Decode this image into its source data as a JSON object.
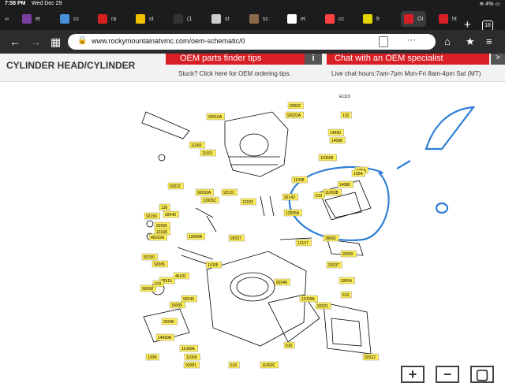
{
  "status": {
    "time": "7:58 PM",
    "date": "Wed Dec 29",
    "battery": "4%"
  },
  "tabs": [
    {
      "label": "et",
      "color": "#7b3fa0"
    },
    {
      "label": "cc",
      "color": "#4a90d9"
    },
    {
      "label": "ra",
      "color": "#d62020"
    },
    {
      "label": "st",
      "color": "#f0c000"
    },
    {
      "label": "(1",
      "color": "#333333"
    },
    {
      "label": "st",
      "color": "#cccccc"
    },
    {
      "label": "sc",
      "color": "#8a6a4a"
    },
    {
      "label": "et",
      "color": "#ffffff"
    },
    {
      "label": "cc",
      "color": "#ff4040"
    },
    {
      "label": "fr",
      "color": "#e6d400"
    },
    {
      "label": "OI",
      "color": "#d81f26"
    },
    {
      "label": "ht",
      "color": "#d81f26"
    }
  ],
  "tab_count": "18",
  "url": "www.rockymountainatvmc.com/oem-schematic/0",
  "page": {
    "title": "CYLINDER HEAD/CYLINDER",
    "promo_left": "OEM parts finder tips",
    "promo_left_sub": "Stuck? Click here for OEM ordering tips.",
    "promo_right": "Chat with an OEM specialist",
    "promo_right_sub": "Live chat hours:7am-7pm Mon-Fri 8am-4pm Sat (MT)"
  },
  "diagram": {
    "code": "E1119",
    "parts": [
      "92015A",
      "92002",
      "92022A",
      "132",
      "11060",
      "14090",
      "14098",
      "11001",
      "110608",
      "130A",
      "11008",
      "14080",
      "11060B",
      "130A",
      "610",
      "92002A",
      "92122",
      "12005C",
      "92143",
      "92022",
      "12005A",
      "92150",
      "12023",
      "130",
      "92043",
      "92065",
      "13169",
      "12005B",
      "92037",
      "39062",
      "92065",
      "46102A",
      "13107",
      "92049",
      "92037",
      "11005",
      "92004",
      "92150",
      "92065",
      "92015",
      "46102",
      "92068",
      "670",
      "92043",
      "16065",
      "11009A",
      "92021",
      "610",
      "92040",
      "14090A",
      "11060A",
      "130B",
      "11009",
      "92081",
      "610",
      "11060C",
      "92022",
      "610"
    ]
  },
  "zoom": {
    "plus": "+",
    "minus": "−"
  }
}
